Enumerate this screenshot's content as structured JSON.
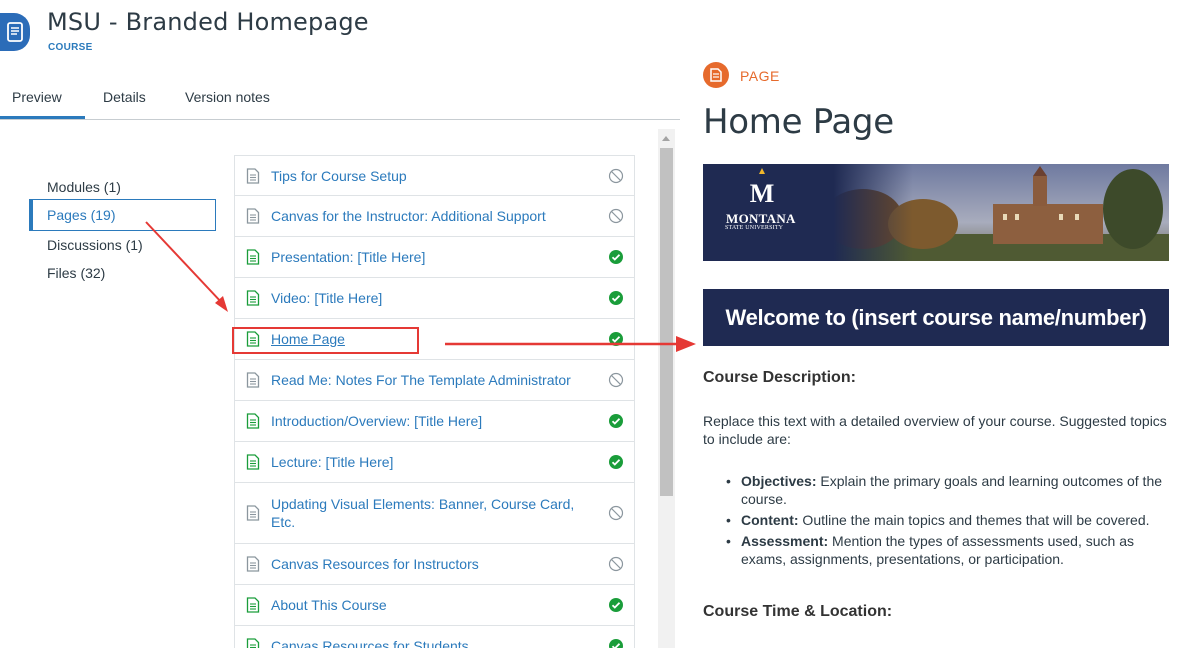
{
  "header": {
    "course_title": "MSU - Branded Homepage",
    "course_type": "COURSE",
    "icon": "course-book-icon"
  },
  "tabs": [
    {
      "label": "Preview",
      "active": true
    },
    {
      "label": "Details",
      "active": false
    },
    {
      "label": "Version notes",
      "active": false
    }
  ],
  "left_nav": {
    "items": [
      {
        "label": "Modules (1)",
        "active": false
      },
      {
        "label": "Pages (19)",
        "active": true
      },
      {
        "label": "Discussions (1)",
        "active": false
      },
      {
        "label": "Files (32)",
        "active": false
      }
    ]
  },
  "pages": [
    {
      "title": "Tips for Course Setup",
      "published": false
    },
    {
      "title": "Canvas for the Instructor: Additional Support",
      "published": false
    },
    {
      "title": "Presentation: [Title Here]",
      "published": true
    },
    {
      "title": "Video: [Title Here]",
      "published": true
    },
    {
      "title": "Home Page",
      "published": true,
      "highlighted": true
    },
    {
      "title": "Read Me: Notes For The Template Administrator",
      "published": false
    },
    {
      "title": "Introduction/Overview: [Title Here]",
      "published": true
    },
    {
      "title": "Lecture: [Title Here]",
      "published": true
    },
    {
      "title": "Updating Visual Elements: Banner, Course Card, Etc.",
      "published": false
    },
    {
      "title": "Canvas Resources for Instructors",
      "published": false
    },
    {
      "title": "About This Course",
      "published": true
    },
    {
      "title": "Canvas Resources for Students",
      "published": true
    }
  ],
  "preview": {
    "kind": "PAGE",
    "title": "Home Page",
    "banner": {
      "logo_line1": "MONTANA",
      "logo_line2": "STATE UNIVERSITY"
    },
    "welcome": "Welcome to (insert course name/number)",
    "course_description_heading": "Course Description:",
    "course_description_text": "Replace this text with a detailed overview of your course. Suggested topics to include are:",
    "bullets": [
      {
        "term": "Objectives:",
        "text": " Explain the primary goals and learning outcomes of the course."
      },
      {
        "term": "Content:",
        "text": " Outline the main topics and themes that will be covered."
      },
      {
        "term": "Assessment:",
        "text": " Mention the types of assessments used, such as exams, assignments, presentations, or participation."
      }
    ],
    "course_time_heading": "Course Time & Location:"
  },
  "colors": {
    "link": "#2b7abc",
    "published": "#1a9d3a",
    "annotation": "#e53935",
    "page_badge": "#e66a2c",
    "banner_navy": "#1f2a52"
  }
}
